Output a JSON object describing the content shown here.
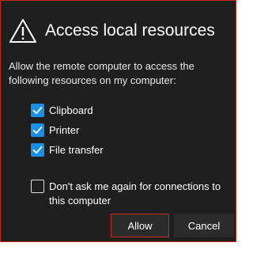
{
  "dialog": {
    "title": "Access local resources",
    "icon": "warning-icon",
    "description_line1": "Allow the remote computer to access the",
    "description_line2": "following resources on my computer:",
    "options": [
      {
        "label": "Clipboard",
        "checked": true
      },
      {
        "label": "Printer",
        "checked": true
      },
      {
        "label": "File transfer",
        "checked": true
      }
    ],
    "dont_ask": {
      "label_line1": "Don't ask me again for connections to",
      "label_line2": "this computer",
      "checked": false
    },
    "buttons": {
      "allow": "Allow",
      "cancel": "Cancel"
    }
  },
  "colors": {
    "background": "#1f1f1f",
    "accent_border": "#c42b1c",
    "checkbox_fill": "#1a8fe8",
    "button_bg": "#2b2b2b",
    "text": "#ffffff"
  }
}
